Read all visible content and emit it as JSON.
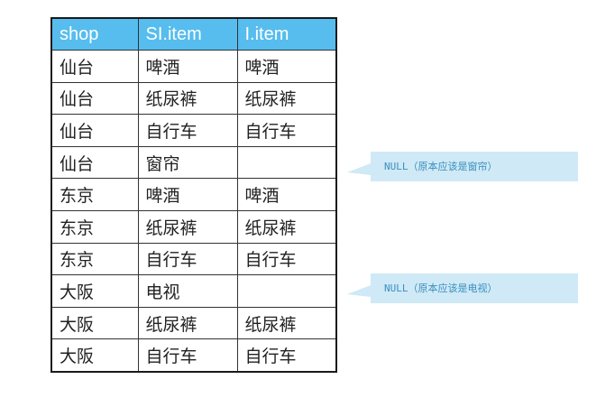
{
  "table": {
    "headers": [
      "shop",
      "SI.item",
      "I.item"
    ],
    "rows": [
      [
        "仙台",
        "啤酒",
        "啤酒"
      ],
      [
        "仙台",
        "纸尿裤",
        "纸尿裤"
      ],
      [
        "仙台",
        "自行车",
        "自行车"
      ],
      [
        "仙台",
        "窗帘",
        ""
      ],
      [
        "东京",
        "啤酒",
        "啤酒"
      ],
      [
        "东京",
        "纸尿裤",
        "纸尿裤"
      ],
      [
        "东京",
        "自行车",
        "自行车"
      ],
      [
        "大阪",
        "电视",
        ""
      ],
      [
        "大阪",
        "纸尿裤",
        "纸尿裤"
      ],
      [
        "大阪",
        "自行车",
        "自行车"
      ]
    ]
  },
  "callouts": [
    {
      "text": "NULL（原本应该是窗帘）"
    },
    {
      "text": "NULL（原本应该是电视）"
    }
  ],
  "colors": {
    "header_bg": "#56bdee",
    "callout_bg": "#cfe9f6",
    "callout_text": "#3a8fbf"
  }
}
